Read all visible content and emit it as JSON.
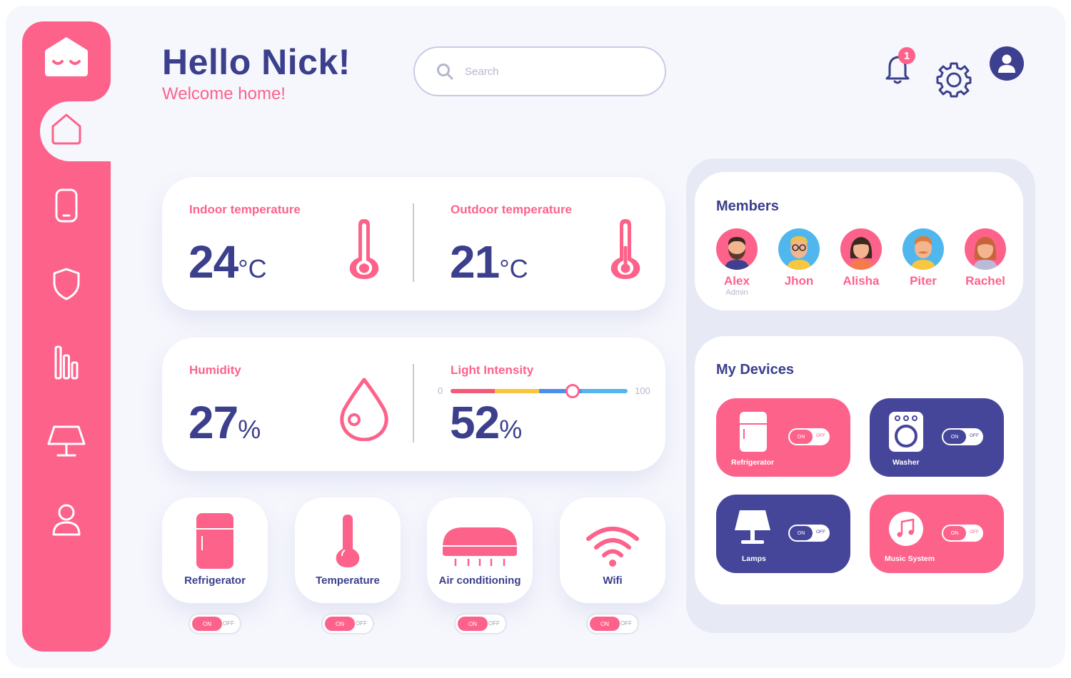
{
  "colors": {
    "accent": "#fd628b",
    "primary": "#3b3f8c",
    "background": "#f6f7fd"
  },
  "header": {
    "greeting": "Hello Nick!",
    "subtitle": "Welcome home!"
  },
  "search": {
    "placeholder": "Search"
  },
  "notifications": {
    "count": "1"
  },
  "sidebar": {
    "items": [
      {
        "icon": "home-icon",
        "active": true
      },
      {
        "icon": "phone-icon"
      },
      {
        "icon": "shield-icon"
      },
      {
        "icon": "bar-chart-icon"
      },
      {
        "icon": "solar-panel-icon"
      },
      {
        "icon": "user-icon"
      }
    ]
  },
  "climate": {
    "indoor": {
      "label": "Indoor temperature",
      "value": "24",
      "unit": "°C"
    },
    "outdoor": {
      "label": "Outdoor temperature",
      "value": "21",
      "unit": "°C"
    },
    "humidity": {
      "label": "Humidity",
      "value": "27",
      "unit": "%"
    },
    "light": {
      "label": "Light Intensity",
      "value": "52",
      "unit": "%",
      "min": "0",
      "max": "100",
      "level": 0.69
    }
  },
  "quick_controls": [
    {
      "label": "Refrigerator",
      "on": "ON",
      "off": "OFF"
    },
    {
      "label": "Temperature",
      "on": "ON",
      "off": "OFF"
    },
    {
      "label": "Air conditioning",
      "on": "ON",
      "off": "OFF"
    },
    {
      "label": "Wifi",
      "on": "ON",
      "off": "OFF"
    }
  ],
  "members": {
    "title": "Members",
    "list": [
      {
        "name": "Alex",
        "role": "Admin"
      },
      {
        "name": "Jhon"
      },
      {
        "name": "Alisha"
      },
      {
        "name": "Piter"
      },
      {
        "name": "Rachel"
      }
    ]
  },
  "devices": {
    "title": "My Devices",
    "list": [
      {
        "label": "Refrigerator",
        "on": "ON",
        "off": "OFF",
        "color": "#fd628b"
      },
      {
        "label": "Washer",
        "on": "ON",
        "off": "OFF",
        "color": "#45469a"
      },
      {
        "label": "Lamps",
        "on": "ON",
        "off": "OFF",
        "color": "#45469a"
      },
      {
        "label": "Music System",
        "on": "ON",
        "off": "OFF",
        "color": "#fd628b"
      }
    ]
  }
}
